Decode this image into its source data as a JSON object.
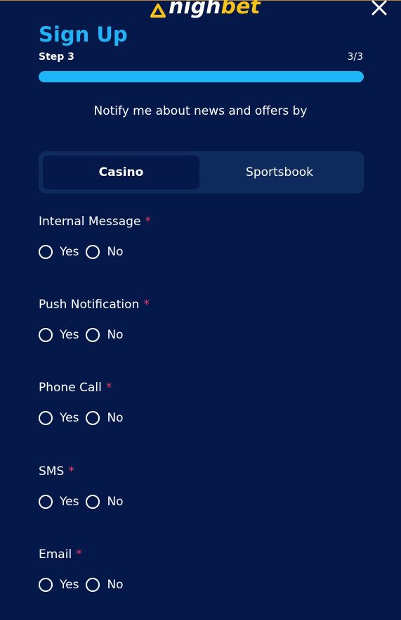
{
  "header": {
    "logo_part1": "nigh",
    "logo_part2": "bet",
    "title": "Sign Up",
    "step_label": "Step 3",
    "step_count": "3/3",
    "progress_fraction": 1.0
  },
  "notify_text": "Notify me about news and offers by",
  "tabs": [
    {
      "label": "Casino",
      "active": true
    },
    {
      "label": "Sportsbook",
      "active": false
    }
  ],
  "groups": [
    {
      "label": "Internal Message",
      "required": "*",
      "yes": "Yes",
      "no": "No"
    },
    {
      "label": "Push Notification",
      "required": "*",
      "yes": "Yes",
      "no": "No"
    },
    {
      "label": "Phone Call",
      "required": "*",
      "yes": "Yes",
      "no": "No"
    },
    {
      "label": "SMS",
      "required": "*",
      "yes": "Yes",
      "no": "No"
    },
    {
      "label": "Email",
      "required": "*",
      "yes": "Yes",
      "no": "No"
    }
  ],
  "colors": {
    "background": "#04184a",
    "accent": "#23b2f5",
    "progress": "#1fb6f7",
    "required": "#e23a6d",
    "brand_yellow": "#f6c21a"
  },
  "icons": {
    "close": "close-icon",
    "logo": "logo-mark-icon"
  }
}
